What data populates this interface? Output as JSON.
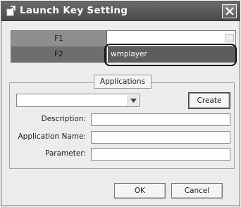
{
  "window": {
    "title": "Launch Key Setting",
    "close_glyph": "✕"
  },
  "keys": [
    {
      "name": "F1",
      "value": ""
    },
    {
      "name": "F2",
      "value": "wmplayer"
    }
  ],
  "applications": {
    "label": "Applications",
    "selected": ""
  },
  "buttons": {
    "create": "Create",
    "ok": "OK",
    "cancel": "Cancel"
  },
  "fields": [
    {
      "label": "Description:",
      "value": ""
    },
    {
      "label": "Application Name:",
      "value": ""
    },
    {
      "label": "Parameter:",
      "value": ""
    }
  ]
}
